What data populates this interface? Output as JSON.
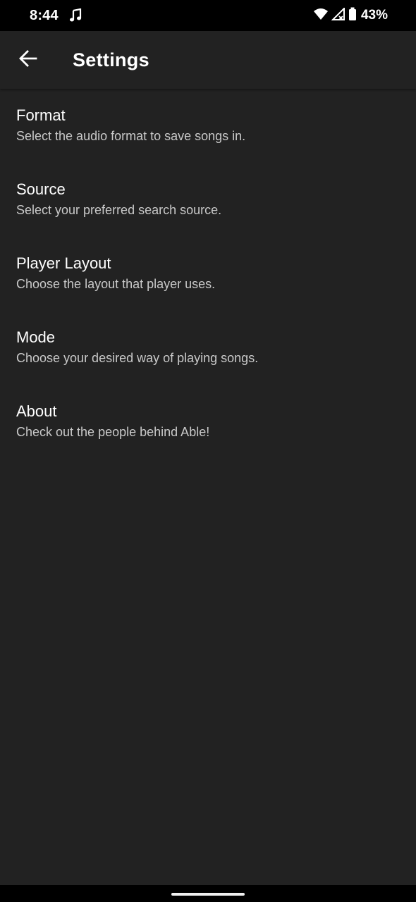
{
  "status_bar": {
    "time": "8:44",
    "battery_percent": "43%",
    "icons": [
      "music-note-icon",
      "wifi-icon",
      "cell-signal-icon",
      "battery-icon"
    ]
  },
  "app_bar": {
    "title": "Settings",
    "back_icon": "arrow-back-icon"
  },
  "settings": {
    "items": [
      {
        "title": "Format",
        "subtitle": "Select the audio format to save songs in."
      },
      {
        "title": "Source",
        "subtitle": "Select your preferred search source."
      },
      {
        "title": "Player Layout",
        "subtitle": "Choose the layout that player uses."
      },
      {
        "title": "Mode",
        "subtitle": "Choose your desired way of playing songs."
      },
      {
        "title": "About",
        "subtitle": "Check out the people behind Able!"
      }
    ]
  },
  "colors": {
    "background": "#222222",
    "status_bar": "#000000",
    "title_text": "#ffffff",
    "subtitle_text": "#c9c9c9"
  }
}
